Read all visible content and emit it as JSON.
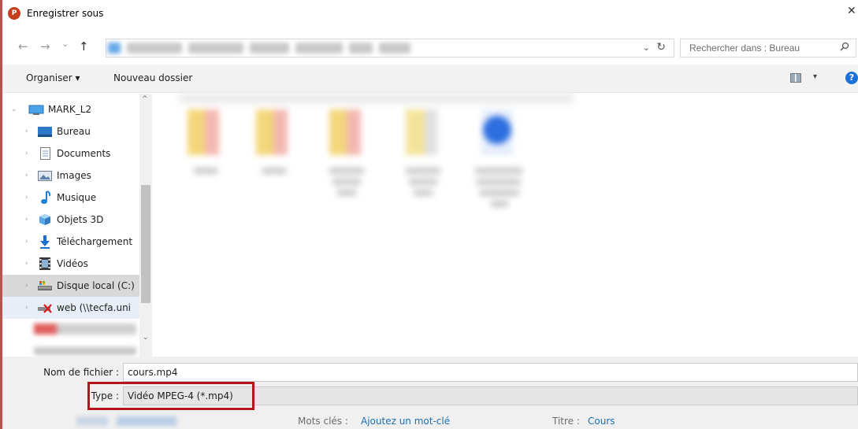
{
  "window": {
    "title": "Enregistrer sous",
    "app_icon_letter": "P",
    "close_glyph": "✕"
  },
  "address": {
    "back_glyph": "←",
    "forward_glyph": "→",
    "recent_glyph": "⌄",
    "up_glyph": "↑",
    "dropdown_glyph": "⌄",
    "refresh_glyph": "↻",
    "search_placeholder": "Rechercher dans : Bureau",
    "search_icon": "search-icon"
  },
  "toolbar": {
    "organize_label": "Organiser ▾",
    "new_folder_label": "Nouveau dossier",
    "view_chevron": "▾",
    "help_label": "?"
  },
  "navpane": {
    "items": [
      {
        "label": "MARK_L2",
        "chevron": "⌄",
        "icon": "computer-icon"
      },
      {
        "label": "Bureau",
        "chevron": "›",
        "icon": "desktop-icon"
      },
      {
        "label": "Documents",
        "chevron": "›",
        "icon": "document-icon"
      },
      {
        "label": "Images",
        "chevron": "›",
        "icon": "images-icon"
      },
      {
        "label": "Musique",
        "chevron": "›",
        "icon": "music-icon"
      },
      {
        "label": "Objets 3D",
        "chevron": "›",
        "icon": "objects-3d-icon"
      },
      {
        "label": "Téléchargement",
        "chevron": "›",
        "icon": "download-icon"
      },
      {
        "label": "Vidéos",
        "chevron": "›",
        "icon": "video-icon"
      },
      {
        "label": "Disque local (C:)",
        "chevron": "›",
        "icon": "drive-icon"
      },
      {
        "label": "web (\\\\tecfa.uni",
        "chevron": "›",
        "icon": "network-drive-disconnected-icon"
      }
    ],
    "scroll_up": "^",
    "scroll_down": "⌄"
  },
  "form": {
    "filename_label": "Nom de fichier :",
    "filename_value": "cours.mp4",
    "type_label": "Type :",
    "type_value": "Vidéo MPEG-4 (*.mp4)",
    "keywords_label": "Mots clés :",
    "keywords_link": "Ajoutez un mot-clé",
    "title_label": "Titre :",
    "title_value": "Cours"
  },
  "colors": {
    "accent_red": "#b3161c",
    "link_blue": "#1a6fb5",
    "app_red": "#c43e1c"
  }
}
